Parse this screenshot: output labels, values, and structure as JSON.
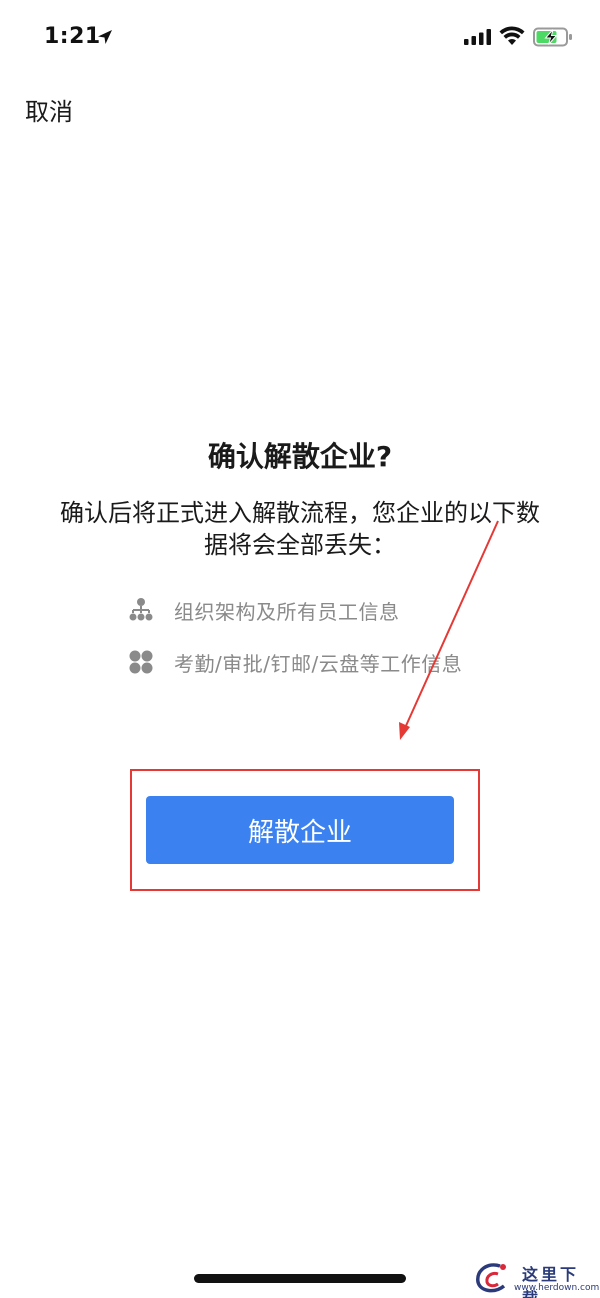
{
  "status_bar": {
    "time": "1:21",
    "icons": [
      "location-arrow-icon",
      "cellular-signal-icon",
      "wifi-icon",
      "battery-charging-icon"
    ]
  },
  "nav": {
    "cancel_label": "取消"
  },
  "dialog": {
    "title": "确认解散企业?",
    "description": "确认后将正式进入解散流程，您企业的以下数据将会全部丢失：",
    "items": [
      {
        "icon": "org-chart-icon",
        "text": "组织架构及所有员工信息"
      },
      {
        "icon": "apps-grid-icon",
        "text": "考勤/审批/钉邮/云盘等工作信息"
      }
    ],
    "confirm_label": "解散企业"
  },
  "colors": {
    "accent": "#3b82f0",
    "annotation": "#e53935",
    "muted_text": "#8a8a8a"
  },
  "watermark": {
    "title": "这里下载",
    "url": "www.herdown.com"
  }
}
